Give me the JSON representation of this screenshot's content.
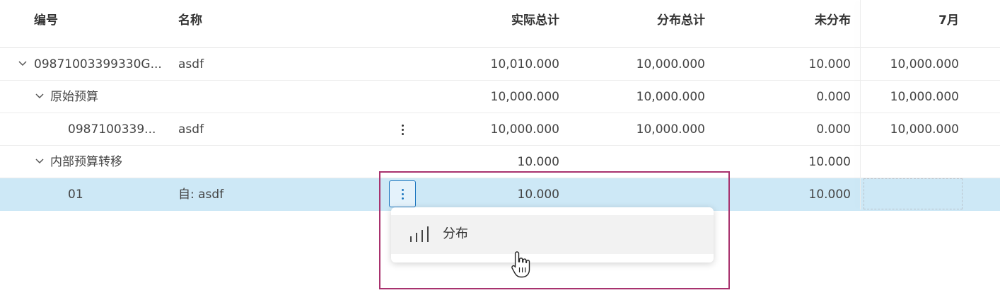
{
  "headers": {
    "code": "编号",
    "name": "名称",
    "actual_total": "实际总计",
    "dist_total": "分布总计",
    "undistributed": "未分布",
    "month": "7月"
  },
  "rows": [
    {
      "code": "09871003399330G...",
      "name": "asdf",
      "actual_total": "10,010.000",
      "dist_total": "10,000.000",
      "undistributed": "10.000",
      "month": "10,000.000"
    },
    {
      "code": "原始预算",
      "name": "",
      "actual_total": "10,000.000",
      "dist_total": "10,000.000",
      "undistributed": "0.000",
      "month": "10,000.000"
    },
    {
      "code": "0987100339...",
      "name": "asdf",
      "actual_total": "10,000.000",
      "dist_total": "10,000.000",
      "undistributed": "0.000",
      "month": "10,000.000"
    },
    {
      "code": "内部预算转移",
      "name": "",
      "actual_total": "10.000",
      "dist_total": "",
      "undistributed": "10.000",
      "month": ""
    },
    {
      "code": "01",
      "name": "自: asdf",
      "actual_total": "10.000",
      "dist_total": "",
      "undistributed": "10.000",
      "month": ""
    }
  ],
  "context_menu": {
    "items": [
      {
        "label": "分布",
        "icon": "bar-chart-icon"
      }
    ]
  },
  "colors": {
    "link": "#1f78c0",
    "selected_row": "#cde8f6",
    "highlight": "#a8326e"
  }
}
